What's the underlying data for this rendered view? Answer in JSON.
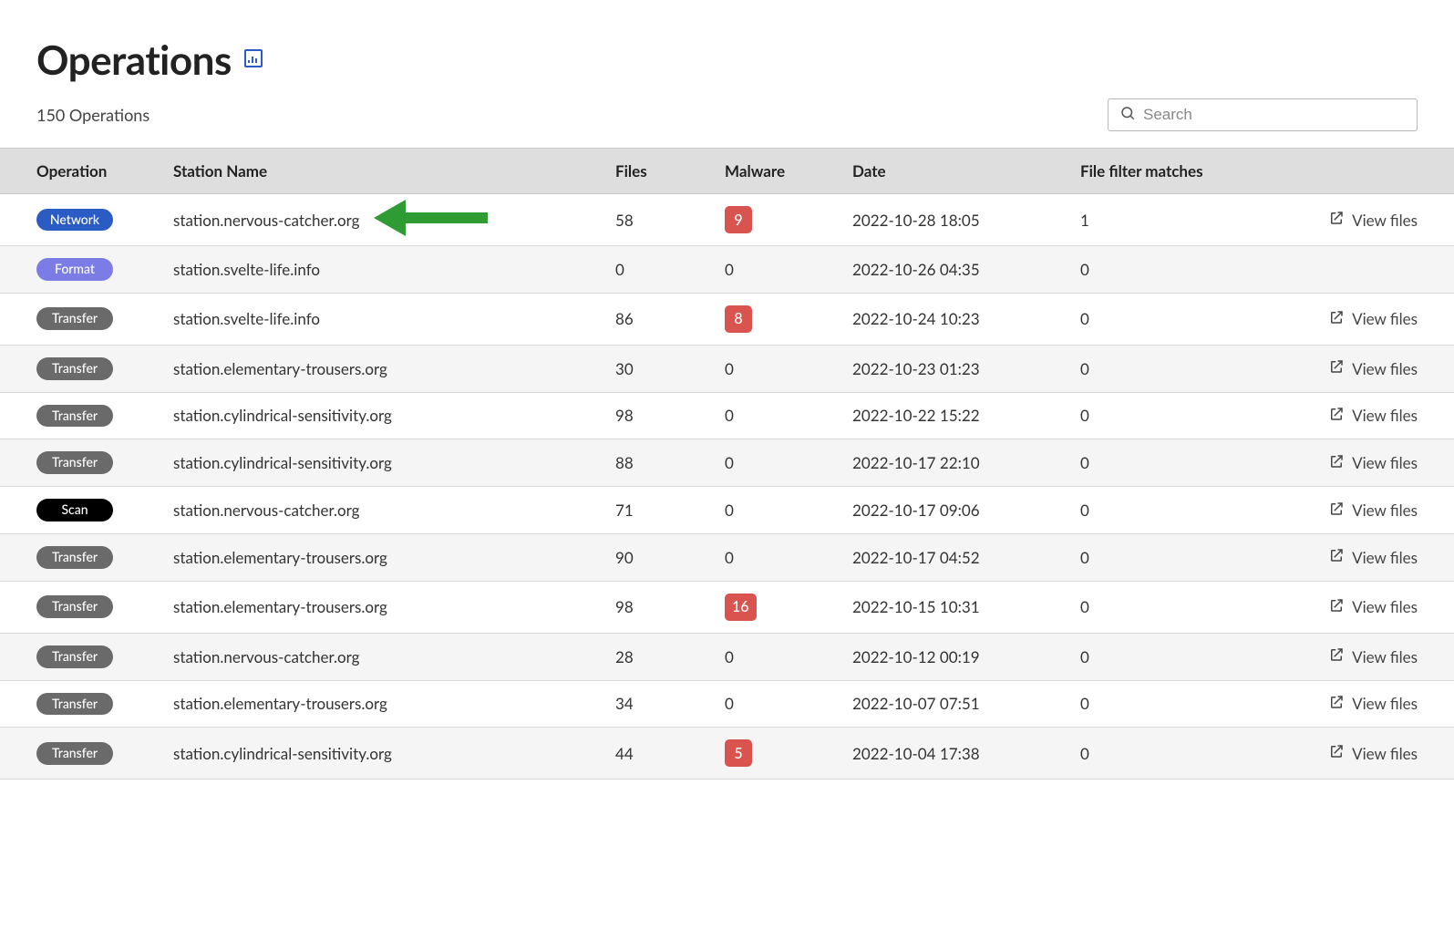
{
  "header": {
    "title": "Operations",
    "count_text": "150 Operations"
  },
  "search": {
    "placeholder": "Search",
    "value": ""
  },
  "columns": {
    "operation": "Operation",
    "station": "Station Name",
    "files": "Files",
    "malware": "Malware",
    "date": "Date",
    "filter": "File filter matches"
  },
  "view_files_label": "View files",
  "badge_styles": {
    "Network": "network",
    "Format": "format",
    "Transfer": "transfer",
    "Scan": "scan"
  },
  "rows": [
    {
      "op": "Network",
      "station": "station.nervous-catcher.org",
      "files": 58,
      "malware": 9,
      "date": "2022-10-28 18:05",
      "filter": 1,
      "view": true,
      "arrow": true
    },
    {
      "op": "Format",
      "station": "station.svelte-life.info",
      "files": 0,
      "malware": 0,
      "date": "2022-10-26 04:35",
      "filter": 0,
      "view": false
    },
    {
      "op": "Transfer",
      "station": "station.svelte-life.info",
      "files": 86,
      "malware": 8,
      "date": "2022-10-24 10:23",
      "filter": 0,
      "view": true
    },
    {
      "op": "Transfer",
      "station": "station.elementary-trousers.org",
      "files": 30,
      "malware": 0,
      "date": "2022-10-23 01:23",
      "filter": 0,
      "view": true
    },
    {
      "op": "Transfer",
      "station": "station.cylindrical-sensitivity.org",
      "files": 98,
      "malware": 0,
      "date": "2022-10-22 15:22",
      "filter": 0,
      "view": true
    },
    {
      "op": "Transfer",
      "station": "station.cylindrical-sensitivity.org",
      "files": 88,
      "malware": 0,
      "date": "2022-10-17 22:10",
      "filter": 0,
      "view": true
    },
    {
      "op": "Scan",
      "station": "station.nervous-catcher.org",
      "files": 71,
      "malware": 0,
      "date": "2022-10-17 09:06",
      "filter": 0,
      "view": true
    },
    {
      "op": "Transfer",
      "station": "station.elementary-trousers.org",
      "files": 90,
      "malware": 0,
      "date": "2022-10-17 04:52",
      "filter": 0,
      "view": true
    },
    {
      "op": "Transfer",
      "station": "station.elementary-trousers.org",
      "files": 98,
      "malware": 16,
      "date": "2022-10-15 10:31",
      "filter": 0,
      "view": true
    },
    {
      "op": "Transfer",
      "station": "station.nervous-catcher.org",
      "files": 28,
      "malware": 0,
      "date": "2022-10-12 00:19",
      "filter": 0,
      "view": true
    },
    {
      "op": "Transfer",
      "station": "station.elementary-trousers.org",
      "files": 34,
      "malware": 0,
      "date": "2022-10-07 07:51",
      "filter": 0,
      "view": true
    },
    {
      "op": "Transfer",
      "station": "station.cylindrical-sensitivity.org",
      "files": 44,
      "malware": 5,
      "date": "2022-10-04 17:38",
      "filter": 0,
      "view": true
    }
  ],
  "annotation": {
    "arrow_color": "#2e9b33"
  }
}
